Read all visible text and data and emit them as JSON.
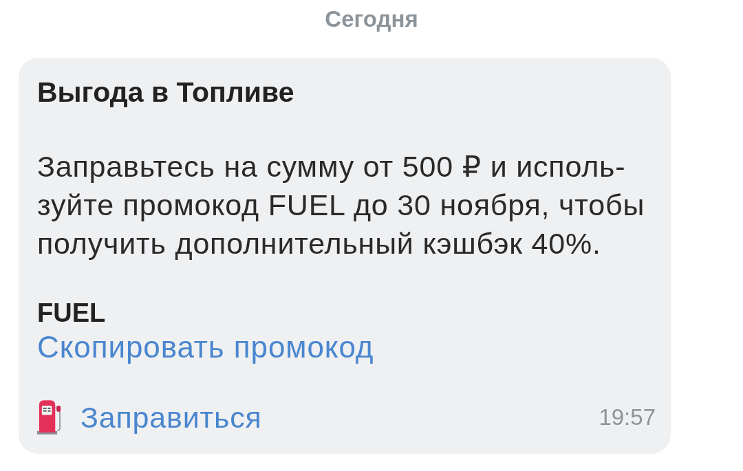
{
  "date_divider": "Сегодня",
  "message": {
    "title": "Выгода в Топливе",
    "body_lines": [
      "Заправьтесь на сумму от 500 ₽ и исполь-",
      "зуйте промокод FUEL до 30 ноября, чтобы",
      "получить дополнительный кэшбэк 40%."
    ],
    "promo_code": "FUEL",
    "copy_link": "Скопировать промокод",
    "action": {
      "label": "Заправиться"
    },
    "time": "19:57"
  }
}
